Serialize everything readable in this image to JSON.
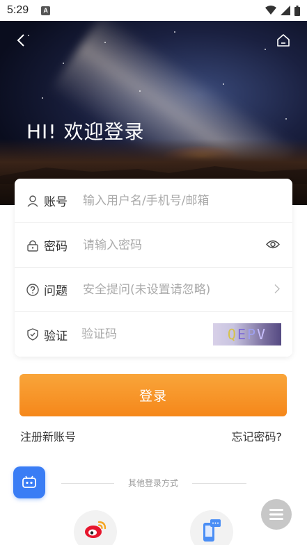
{
  "status_bar": {
    "time": "5:29",
    "notification_icon": "A"
  },
  "hero": {
    "title": "HI! 欢迎登录"
  },
  "form": {
    "account": {
      "label": "账号",
      "placeholder": "输入用户名/手机号/邮箱"
    },
    "password": {
      "label": "密码",
      "placeholder": "请输入密码"
    },
    "question": {
      "label": "问题",
      "placeholder": "安全提问(未设置请忽略)"
    },
    "verify": {
      "label": "验证",
      "placeholder": "验证码",
      "captcha": [
        "Q",
        "E",
        "P",
        "V"
      ]
    }
  },
  "actions": {
    "login_label": "登录",
    "register_label": "注册新账号",
    "forgot_label": "忘记密码?"
  },
  "other_login": {
    "label": "其他登录方式"
  },
  "colors": {
    "accent_orange": "#f5871a",
    "robot_blue": "#3a7df5"
  }
}
